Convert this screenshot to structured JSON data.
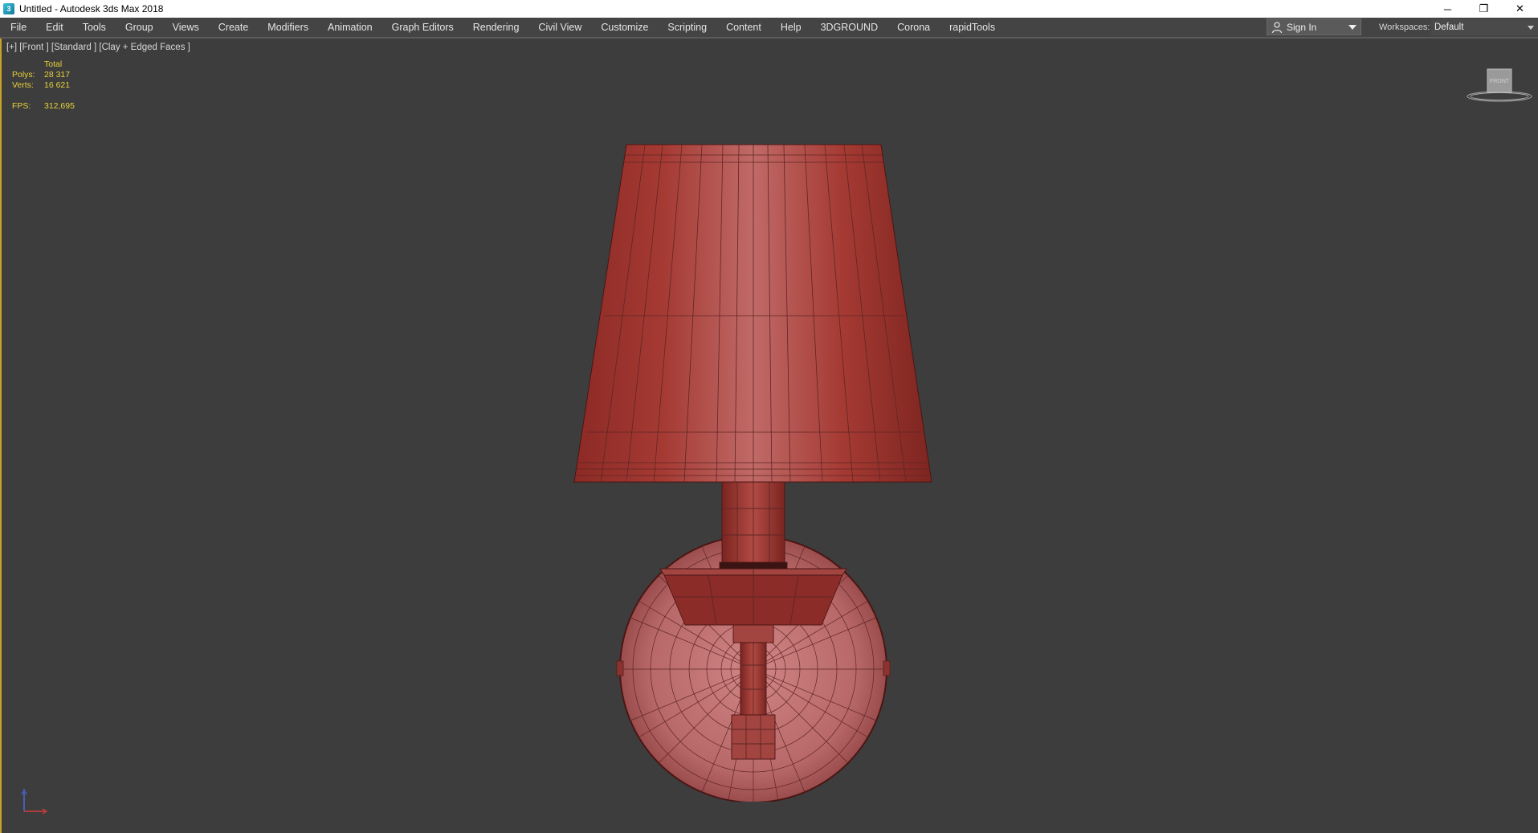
{
  "window": {
    "title": "Untitled - Autodesk 3ds Max 2018",
    "icon": "3dsmax-app-icon",
    "controls": {
      "minimize": "─",
      "restore": "❐",
      "close": "✕"
    }
  },
  "menubar": {
    "items": [
      {
        "label": "File"
      },
      {
        "label": "Edit"
      },
      {
        "label": "Tools"
      },
      {
        "label": "Group"
      },
      {
        "label": "Views"
      },
      {
        "label": "Create"
      },
      {
        "label": "Modifiers"
      },
      {
        "label": "Animation"
      },
      {
        "label": "Graph Editors"
      },
      {
        "label": "Rendering"
      },
      {
        "label": "Civil View"
      },
      {
        "label": "Customize"
      },
      {
        "label": "Scripting"
      },
      {
        "label": "Content"
      },
      {
        "label": "Help"
      },
      {
        "label": "3DGROUND"
      },
      {
        "label": "Corona"
      },
      {
        "label": "rapidTools"
      }
    ],
    "signin_label": "Sign In",
    "workspaces_label": "Workspaces:",
    "workspace_value": "Default"
  },
  "viewport": {
    "label": "[+] [Front ] [Standard ] [Clay + Edged Faces ]",
    "stats": {
      "header": "Total",
      "polys_label": "Polys:",
      "polys_value": "28 317",
      "verts_label": "Verts:",
      "verts_value": "16 621",
      "fps_label": "FPS:",
      "fps_value": "312,695"
    },
    "viewcube_label": "FRONT",
    "colors": {
      "background": "#3d3d3d",
      "stats_text": "#e8d23a",
      "model": "#b04040",
      "active_border": "#c9a227"
    }
  }
}
